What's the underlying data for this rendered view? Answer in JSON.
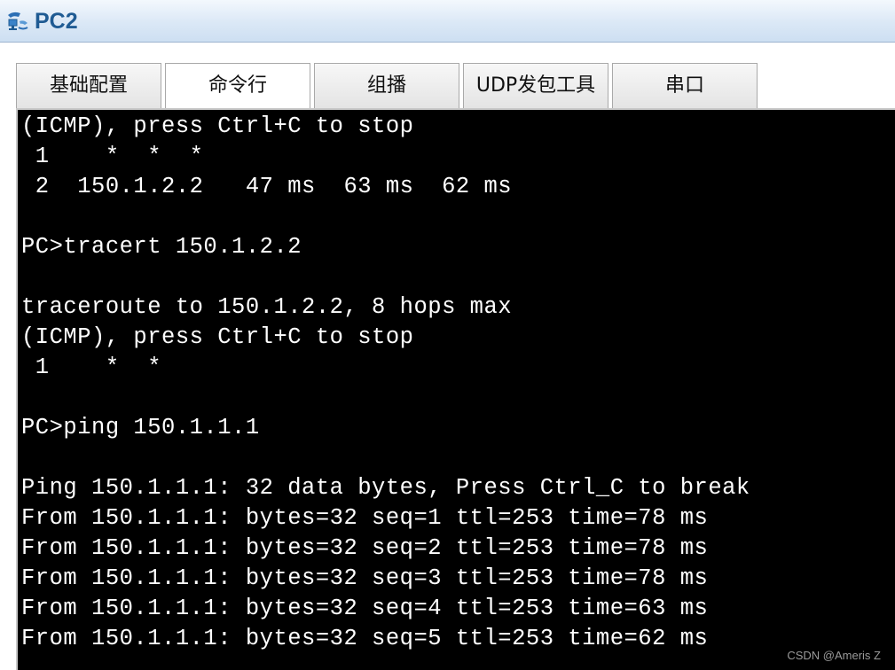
{
  "window": {
    "title": "PC2",
    "icon": "network-pc-icon"
  },
  "tabs": [
    {
      "label": "基础配置",
      "active": false
    },
    {
      "label": "命令行",
      "active": true
    },
    {
      "label": "组播",
      "active": false
    },
    {
      "label": "UDP发包工具",
      "active": false
    },
    {
      "label": "串口",
      "active": false
    }
  ],
  "terminal": {
    "background": "#000000",
    "foreground": "#ffffff",
    "lines": [
      "(ICMP), press Ctrl+C to stop",
      " 1    *  *  *",
      " 2  150.1.2.2   47 ms  63 ms  62 ms",
      "",
      "PC>tracert 150.1.2.2",
      "",
      "traceroute to 150.1.2.2, 8 hops max",
      "(ICMP), press Ctrl+C to stop",
      " 1    *  *",
      "",
      "PC>ping 150.1.1.1",
      "",
      "Ping 150.1.1.1: 32 data bytes, Press Ctrl_C to break",
      "From 150.1.1.1: bytes=32 seq=1 ttl=253 time=78 ms",
      "From 150.1.1.1: bytes=32 seq=2 ttl=253 time=78 ms",
      "From 150.1.1.1: bytes=32 seq=3 ttl=253 time=78 ms",
      "From 150.1.1.1: bytes=32 seq=4 ttl=253 time=63 ms",
      "From 150.1.1.1: bytes=32 seq=5 ttl=253 time=62 ms"
    ]
  },
  "watermark": "CSDN @Ameris Z",
  "colors": {
    "title_text": "#1f5b93",
    "titlebar_bg": "#dbe8f6"
  }
}
